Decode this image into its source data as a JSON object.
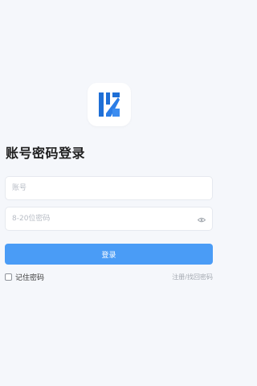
{
  "login": {
    "title": "账号密码登录",
    "account_placeholder": "账号",
    "password_placeholder": "8-20位密码",
    "login_button": "登录",
    "remember_label": "记住密码",
    "register_link": "注册/找回密码"
  },
  "icons": {
    "logo": "app-logo",
    "password_toggle": "eye-icon",
    "remember": "checkbox-icon"
  },
  "colors": {
    "background": "#f5f7fb",
    "primary": "#4a9cf6",
    "logo_blue": "#1f6fd6",
    "muted_text": "#a3a8b0"
  }
}
